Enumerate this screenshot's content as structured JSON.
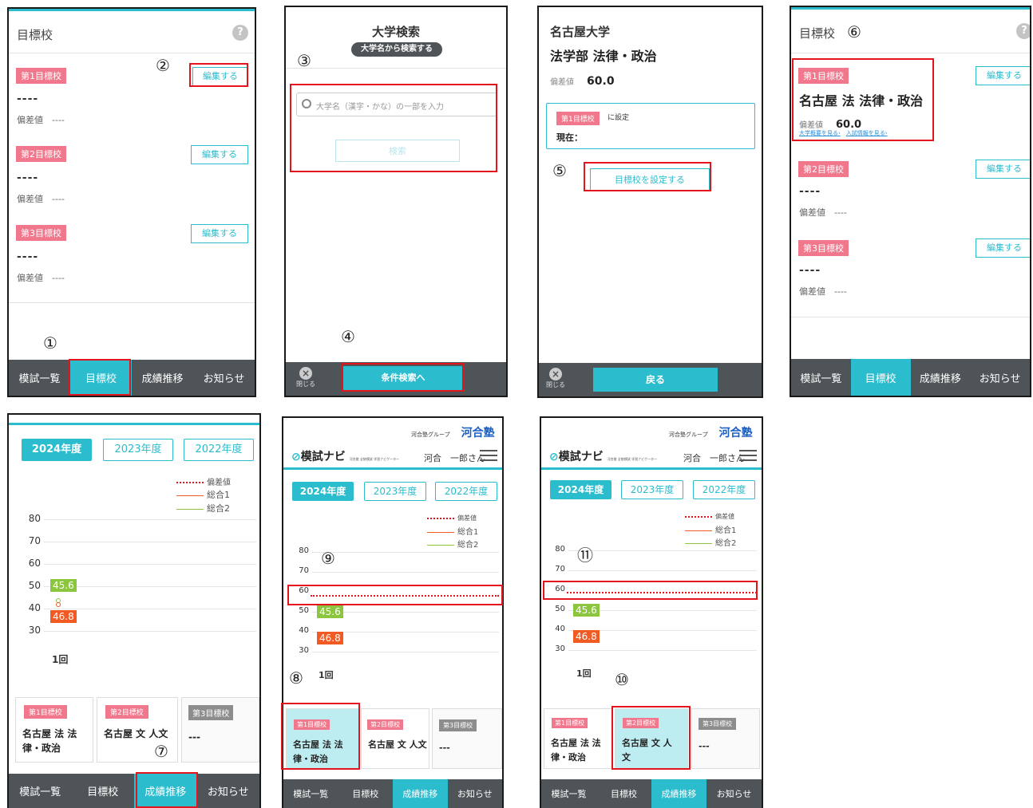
{
  "markers": [
    "①",
    "②",
    "③",
    "④",
    "⑤",
    "⑥",
    "⑦",
    "⑧",
    "⑨",
    "⑩",
    "⑪"
  ],
  "nav": {
    "exams": "模試一覧",
    "target": "目標校",
    "grades": "成績推移",
    "news": "お知らせ"
  },
  "target_screen": {
    "title": "目標校",
    "help": "?",
    "slots": [
      "第1目標校",
      "第2目標校",
      "第3目標校"
    ],
    "empty_name": "----",
    "deviation_label": "偏差値",
    "empty_deviation": "----",
    "edit_label": "編集する"
  },
  "search_screen": {
    "title": "大学検索",
    "subtitle": "大学名から検索する",
    "placeholder": "大学名（漢字・かな）の一部を入力",
    "search_button": "検索",
    "condition_button": "条件検索へ",
    "close_label": "閉じる"
  },
  "set_screen": {
    "university": "名古屋大学",
    "department": "法学部 法律・政治",
    "deviation_label": "偏差値",
    "deviation": "60.0",
    "slot_badge": "第1目標校",
    "slot_suffix": "に設定",
    "current_label": "現在：",
    "set_button": "目標校を設定する",
    "back_button": "戻る",
    "close_label": "閉じる"
  },
  "target_filled": {
    "name": "名古屋 法 法律・政治",
    "deviation": "60.0",
    "link1": "大学概要を見る›",
    "link2": "入試情報を見る›"
  },
  "grades_screen": {
    "years": [
      "2024年度",
      "2023年度",
      "2022年度"
    ],
    "legend": [
      "偏差値",
      "総合1",
      "総合2"
    ],
    "yticks": [
      "80",
      "70",
      "60",
      "50",
      "40",
      "30"
    ],
    "value1": "45.6",
    "value2": "46.8",
    "x_label": "1回",
    "card1_name": "名古屋 法 法律・政治",
    "card2_name": "名古屋 文 人文",
    "card3_name": "---",
    "brand": "模試ナビ",
    "brand_sub": "河合塾 全統模試 学習ナビゲーター",
    "group": "河合塾グループ",
    "group_logo": "河合塾",
    "user": "河合　一郎さん"
  },
  "colors": {
    "accent": "#2bbcce",
    "badge": "#f1788c",
    "nav": "#4e5457",
    "highlight": "#e3141b",
    "orange": "#f15a22",
    "green": "#8cc63f"
  }
}
